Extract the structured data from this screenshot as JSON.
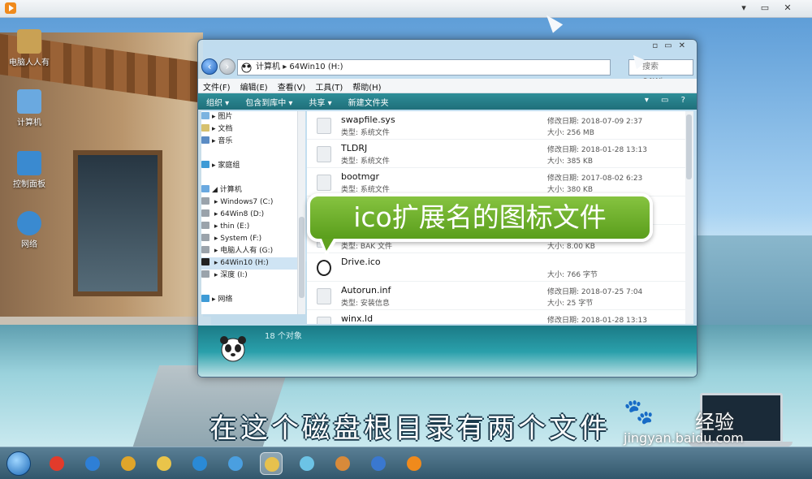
{
  "player": {
    "controls": [
      "▾",
      "▭",
      "✕"
    ]
  },
  "desktop_icons": [
    {
      "label": "电脑人人有",
      "color": "#c9a154"
    },
    {
      "label": "计算机",
      "color": "#6aa9e0"
    },
    {
      "label": "控制面板",
      "color": "#3a8ad0"
    },
    {
      "label": "网络",
      "color": "#3a8ad0"
    }
  ],
  "explorer": {
    "title_controls": [
      "▫",
      "▭",
      "✕"
    ],
    "address": [
      "计算机",
      "▸",
      "64Win10 (H:)"
    ],
    "search_placeholder": "搜索 64Win...",
    "menu": [
      "文件(F)",
      "编辑(E)",
      "查看(V)",
      "工具(T)",
      "帮助(H)"
    ],
    "toolbar": [
      "组织 ▾",
      "包含到库中 ▾",
      "共享 ▾",
      "新建文件夹"
    ],
    "toolbar_right": "▾ ▭ ?",
    "nav": [
      {
        "label": "▸ 图片",
        "icon": "#7bb3e0",
        "sel": false
      },
      {
        "label": "▸ 文档",
        "icon": "#d6c16e",
        "sel": false
      },
      {
        "label": "▸ 音乐",
        "icon": "#5b8cc4",
        "sel": false
      },
      {
        "label": "",
        "icon": "",
        "sel": false
      },
      {
        "label": "▸ 家庭组",
        "icon": "#3e9bd6",
        "sel": false
      },
      {
        "label": "",
        "icon": "",
        "sel": false
      },
      {
        "label": "◢ 计算机",
        "icon": "#6aa9e0",
        "sel": false
      },
      {
        "label": "  ▸ Windows7 (C:)",
        "icon": "#9aa3ab",
        "sel": false
      },
      {
        "label": "  ▸ 64Win8 (D:)",
        "icon": "#9aa3ab",
        "sel": false
      },
      {
        "label": "  ▸ thin (E:)",
        "icon": "#9aa3ab",
        "sel": false
      },
      {
        "label": "  ▸ System (F:)",
        "icon": "#9aa3ab",
        "sel": false
      },
      {
        "label": "  ▸ 电脑人人有 (G:)",
        "icon": "#9aa3ab",
        "sel": false
      },
      {
        "label": "  ▸ 64Win10 (H:)",
        "icon": "#222",
        "sel": true
      },
      {
        "label": "  ▸ 深度 (I:)",
        "icon": "#9aa3ab",
        "sel": false
      },
      {
        "label": "",
        "icon": "",
        "sel": false
      },
      {
        "label": "▸ 网络",
        "icon": "#3e9bd6",
        "sel": false
      }
    ],
    "files": [
      {
        "name": "swapfile.sys",
        "type": "类型: 系统文件",
        "date": "修改日期: 2018-07-09 2:37",
        "size": "大小: 256 MB"
      },
      {
        "name": "TLDRJ",
        "type": "类型: 系统文件",
        "date": "修改日期: 2018-01-28 13:13",
        "size": "大小: 385 KB"
      },
      {
        "name": "bootmgr",
        "type": "类型: 系统文件",
        "date": "修改日期: 2017-08-02 6:23",
        "size": "大小: 380 KB"
      },
      {
        "name": "",
        "type": "",
        "date": "",
        "size": ""
      },
      {
        "name": "",
        "type": "类型: BAK 文件",
        "date": "",
        "size": "大小: 8.00 KB"
      },
      {
        "name": "Drive.ico",
        "type": "",
        "date": "",
        "size": "大小: 766 字节"
      },
      {
        "name": "Autorun.inf",
        "type": "类型: 安装信息",
        "date": "修改日期: 2018-07-25 7:04",
        "size": "大小: 25 字节"
      },
      {
        "name": "winx.ld",
        "type": "",
        "date": "修改日期: 2018-01-28 13:13",
        "size": ""
      }
    ],
    "status_count": "18 个对象"
  },
  "callout": "ico扩展名的图标文件",
  "subtitle": "在这个磁盘根目录有两个文件",
  "watermark": {
    "brand": "经验",
    "url": "jingyan.baidu.com"
  },
  "taskbar_apps": [
    {
      "name": "jiangmin-antivirus-icon",
      "color": "#e23b2b",
      "active": false
    },
    {
      "name": "internet-explorer-icon",
      "color": "#2e7fd6",
      "active": false
    },
    {
      "name": "chrome-icon",
      "color": "#e0a52a",
      "active": false
    },
    {
      "name": "folder-icon",
      "color": "#e9c44a",
      "active": false
    },
    {
      "name": "browser-icon",
      "color": "#2a8ad6",
      "active": false
    },
    {
      "name": "control-panel-icon",
      "color": "#4a9fe0",
      "active": false
    },
    {
      "name": "explorer-icon",
      "color": "#e7c14d",
      "active": true
    },
    {
      "name": "pinwheel-icon",
      "color": "#6cc3e6",
      "active": false
    },
    {
      "name": "paint-icon",
      "color": "#d88a3a",
      "active": false
    },
    {
      "name": "media-icon",
      "color": "#3a78d0",
      "active": false
    },
    {
      "name": "player-icon",
      "color": "#f08a1c",
      "active": false
    }
  ]
}
